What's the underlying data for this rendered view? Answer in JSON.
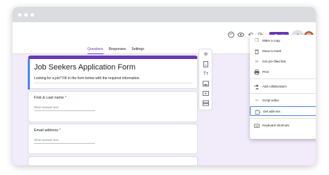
{
  "toolbar": {
    "send_label": "Send"
  },
  "tabs": [
    {
      "label": "Questions"
    },
    {
      "label": "Responses"
    },
    {
      "label": "Settings"
    }
  ],
  "form": {
    "title": "Job Seekers Application Form",
    "description": "Looking for a job? Fill in the form below with the required information."
  },
  "questions": [
    {
      "label": "First & Last name",
      "required_mark": "*",
      "placeholder": "Short answer text"
    },
    {
      "label": "Email address",
      "required_mark": "*",
      "placeholder": "Short answer text"
    }
  ],
  "menu": {
    "items": [
      {
        "label": "Make a copy",
        "icon": "copy-icon"
      },
      {
        "label": "Move to trash",
        "icon": "trash-icon"
      },
      {
        "label": "Get pre-filled link",
        "icon": "link-icon"
      },
      {
        "label": "Print",
        "icon": "print-icon"
      },
      {
        "label": "Add collaborators",
        "icon": "add-person-icon"
      },
      {
        "label": "Script editor",
        "icon": "code-icon"
      },
      {
        "label": "Get add-ons",
        "icon": "puzzle-icon"
      },
      {
        "label": "Keyboard shortcuts",
        "icon": "keyboard-icon"
      }
    ]
  },
  "colors": {
    "accent": "#673ab7",
    "background": "#f1ebfa",
    "highlight_border": "#4a7fd8",
    "required": "#d93025"
  }
}
